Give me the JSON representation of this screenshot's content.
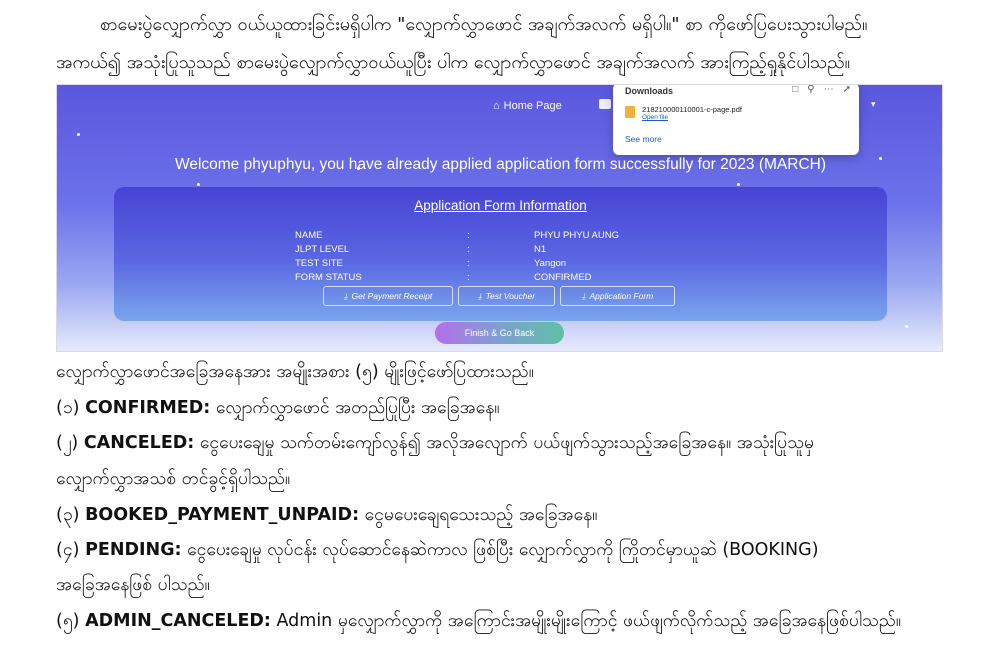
{
  "doc": {
    "para1": "စာမေးပွဲလျှောက်လွှာ ဝယ်ယူထားခြင်းမရှိပါက \"လျှောက်လွှာဖောင် အချက်အလက် မရှိပါ။\" စာ ကိုဖော်ပြပေးသွားပါမည်။",
    "para2": "အကယ်၍ အသုံးပြုသူသည် စာမေးပွဲလျှောက်လွှာဝယ်ယူပြီး ပါက လျှောက်လွှာဖောင် အချက်အလက် အားကြည့်ရှုနိုင်ပါသည်။",
    "intro": "လျှောက်လွှာဖောင်အခြေအနေအား အမျိုးအစား (၅) မျိုးဖြင့်ဖော်ပြထားသည်။",
    "items": [
      {
        "num": "(၁)",
        "label": "CONFIRMED:",
        "desc": " လျှောက်လွှာဖောင် အတည်ပြုပြီး အခြေအနေ။"
      },
      {
        "num": "(၂)",
        "label": "CANCELED:",
        "desc": " ငွေပေးချေမှု သက်တမ်းကျော်လွန်၍ အလိုအလျောက် ပယ်ဖျက်သွားသည့်အခြေအနေ။ အသုံးပြုသူမှ",
        "desc2": "လျှောက်လွှာအသစ် တင်ခွင့်ရှိပါသည်။"
      },
      {
        "num": "(၃)",
        "label": "BOOKED_PAYMENT_UNPAID:",
        "desc": " ငွေမပေးချေရသေးသည့် အခြေအနေ။"
      },
      {
        "num": "(၄)",
        "label": "PENDING:",
        "desc": " ငွေပေးချေမှု လုပ်ငန်း လုပ်ဆောင်နေဆဲကာလ ဖြစ်ပြီး လျှောက်လွှာကို ကြိုတင်မှာယူဆဲ (BOOKING)",
        "desc2": "အခြေအနေဖြစ် ပါသည်။"
      },
      {
        "num": "(၅)",
        "label": "ADMIN_CANCELED:",
        "desc": " Admin မှလျှောက်လွှာကို အကြောင်းအမျိုးမျိုးကြောင့် ဖယ်ဖျက်လိုက်သည့် အခြေအနေဖြစ်ပါသည်။"
      }
    ]
  },
  "screenshot": {
    "nav_home": "Home Page",
    "downloads": {
      "title": "Downloads",
      "file_name": "218210000110001-c-page.pdf",
      "open_file": "Open file",
      "see_more": "See more"
    },
    "welcome": "Welcome phyuphyu, you have already applied application form successfully for 2023 (MARCH)",
    "card_title": "Application Form Information",
    "rows": [
      {
        "key": "NAME",
        "value": "PHYU PHYU AUNG"
      },
      {
        "key": "JLPT LEVEL",
        "value": "N1"
      },
      {
        "key": "TEST SITE",
        "value": "Yangon"
      },
      {
        "key": "FORM STATUS",
        "value": "CONFIRMED"
      }
    ],
    "colon": ":",
    "buttons": [
      "Get Payment Receipt",
      "Test Voucher",
      "Application Form"
    ],
    "finish": "Finish & Go Back"
  }
}
